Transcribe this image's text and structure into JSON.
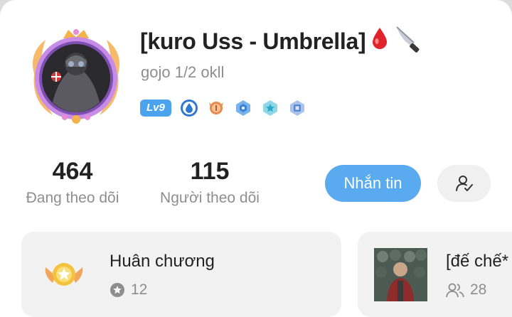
{
  "profile": {
    "name": "[kuro Uss - Umbrella]",
    "name_emojis": [
      "drop-of-blood-icon",
      "kitchen-knife-icon"
    ],
    "bio": "gojo 1/2 okll",
    "level": "Lv9",
    "badges": [
      "blue-drop-badge",
      "orange-medal-badge",
      "blue-gem-badge",
      "teal-star-badge",
      "blue-crest-badge"
    ]
  },
  "stats": {
    "following_count": "464",
    "following_label": "Đang theo dõi",
    "followers_count": "115",
    "followers_label": "Người theo dõi"
  },
  "actions": {
    "message_label": "Nhắn tin",
    "follow_icon": "person-check-icon"
  },
  "cards": {
    "medal": {
      "title": "Huân chương",
      "count": "12"
    },
    "group": {
      "title": "[đế chế*",
      "count": "28"
    }
  },
  "colors": {
    "accent": "#5aaaf0",
    "level_badge": "#4aa3ec",
    "muted_text": "#8e8e8e"
  }
}
